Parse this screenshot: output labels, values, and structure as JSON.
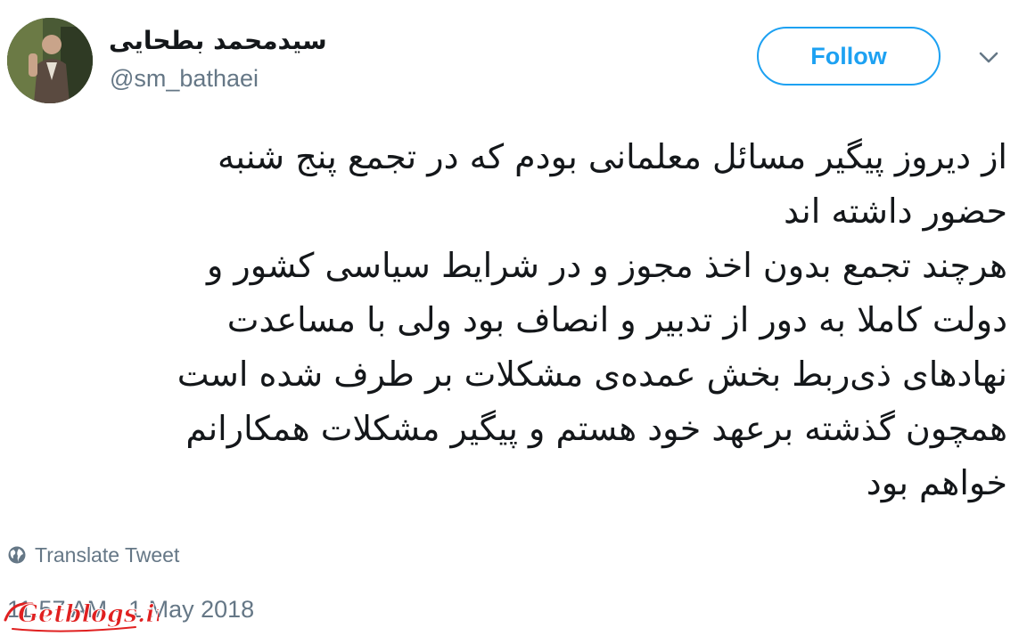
{
  "tweet": {
    "author": {
      "display_name": "سیدمحمد بطحایی",
      "handle": "@sm_bathaei",
      "avatar_icon": "profile-photo"
    },
    "follow_label": "Follow",
    "menu_icon": "chevron-down-icon",
    "text_lines": [
      "از دیروز پیگیر مسائل معلمانی بودم که در تجمع پنج شنبه",
      "حضور داشته اند",
      "هرچند تجمع بدون اخذ مجوز و در شرایط سیاسی کشور و",
      "دولت کاملا به دور از تدبیر و انصاف بود ولی با مساعدت",
      "نهادهای ذی‌ربط بخش عمده‌ی مشکلات بر طرف شده است",
      "همچون گذشته برعهد خود هستم و پیگیر مشکلات همکارانم",
      "خواهم بود"
    ],
    "translate_label": "Translate Tweet",
    "timestamp": "11:57 AM - 1 May 2018"
  },
  "watermark": {
    "text": "Getblogs.ir",
    "color": "#e02020"
  },
  "colors": {
    "accent": "#1da1f2",
    "text": "#14171a",
    "secondary": "#657786"
  }
}
